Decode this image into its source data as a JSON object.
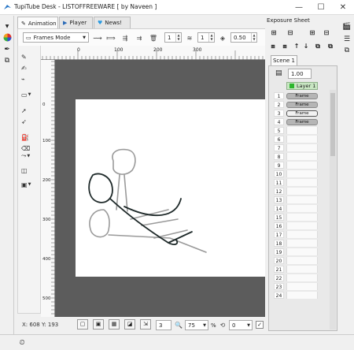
{
  "window": {
    "title": "TupiTube Desk - LISTOFFREEWARE [ by Naveen ]",
    "minimize": "—",
    "maximize": "☐",
    "close": "✕"
  },
  "tabs": [
    {
      "label": "Animation",
      "icon": "✎"
    },
    {
      "label": "Player",
      "icon": "▶"
    },
    {
      "label": "News!",
      "icon": "🐦"
    }
  ],
  "toolbar": {
    "mode": "Frames Mode",
    "spin1": "1",
    "spin2": "1",
    "opacity": "0.50"
  },
  "ruler": {
    "top_ticks": [
      "0",
      "100",
      "200",
      "300"
    ],
    "left_ticks": [
      "0",
      "100",
      "200",
      "300",
      "400",
      "500"
    ]
  },
  "status": {
    "coords": "X: 608 Y: 193",
    "frame_num": "3",
    "zoom": "75",
    "percent_sign": "%",
    "rotation": "0"
  },
  "exposure": {
    "title": "Exposure Sheet",
    "scene_tab": "Scene 1",
    "opacity": "1.00",
    "layer_name": "Layer 1",
    "frame_label": "Frame",
    "frames": [
      1,
      2,
      3,
      4
    ],
    "selected_frame": 3,
    "rows": [
      "1",
      "2",
      "3",
      "4",
      "5",
      "6",
      "7",
      "8",
      "9",
      "10",
      "11",
      "12",
      "13",
      "14",
      "15",
      "16",
      "17",
      "18",
      "19",
      "20",
      "21",
      "22",
      "23",
      "24"
    ]
  },
  "colors": {
    "workspace": "#5c5c5c",
    "layer_accent": "#2db62d",
    "sketch_gray": "#9a9a9a",
    "sketch_dark": "#1f2a2a"
  }
}
